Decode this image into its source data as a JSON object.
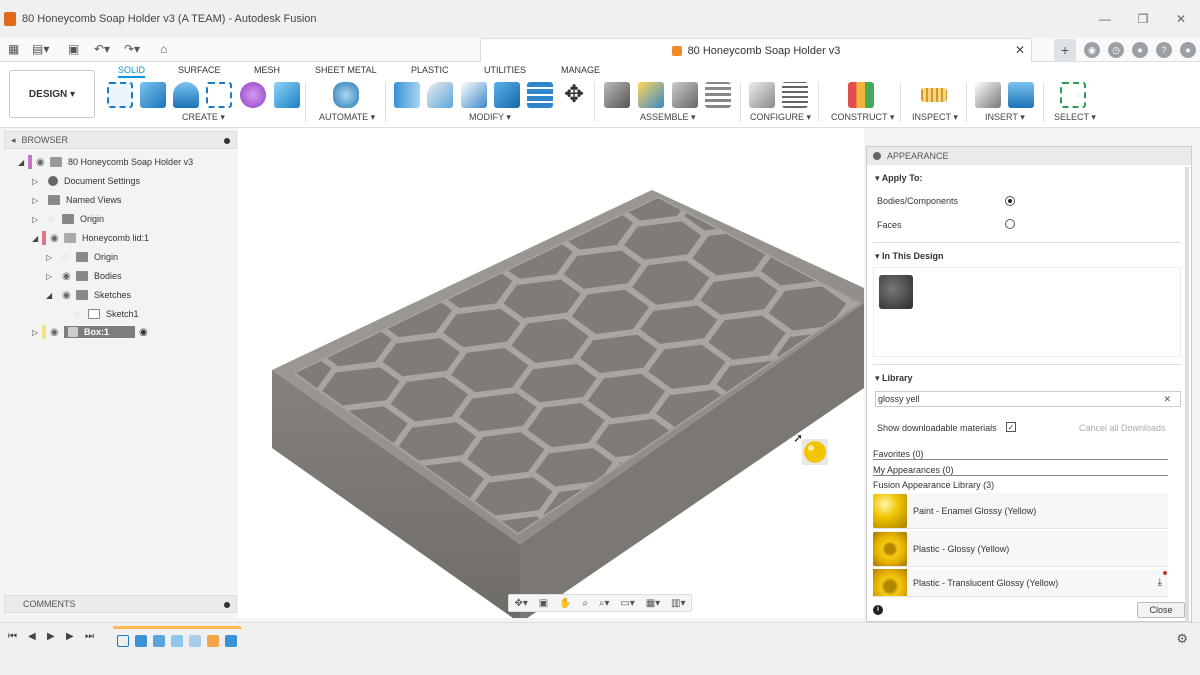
{
  "window": {
    "title": "80 Honeycomb Soap Holder v3 (A TEAM) - Autodesk Fusion",
    "controls": [
      "—",
      "❐",
      "✕"
    ]
  },
  "doc_tab": {
    "title": "80 Honeycomb Soap Holder v3"
  },
  "ribbon": {
    "workspace": "DESIGN",
    "tabs": [
      "SOLID",
      "SURFACE",
      "MESH",
      "SHEET METAL",
      "PLASTIC",
      "UTILITIES",
      "MANAGE"
    ],
    "groups": [
      "CREATE",
      "AUTOMATE",
      "MODIFY",
      "ASSEMBLE",
      "CONFIGURE",
      "CONSTRUCT",
      "INSPECT",
      "INSERT",
      "SELECT"
    ]
  },
  "browser": {
    "title": "BROWSER",
    "rows": [
      "80 Honeycomb Soap Holder v3",
      "Document Settings",
      "Named Views",
      "Origin",
      "Honeycomb lid:1",
      "Origin",
      "Bodies",
      "Sketches",
      "Sketch1",
      "Box:1"
    ]
  },
  "comments": {
    "title": "COMMENTS"
  },
  "appearance": {
    "title": "APPEARANCE",
    "apply_to": "Apply To:",
    "bodies_components": "Bodies/Components",
    "faces": "Faces",
    "in_this_design": "In This Design",
    "library": "Library",
    "search_value": "glossy yell",
    "show_downloadable": "Show downloadable materials",
    "cancel_downloads": "Cancel all Downloads",
    "favorites": "Favorites (0)",
    "my_appearances": "My Appearances (0)",
    "fusion_library": "Fusion Appearance Library (3)",
    "materials": [
      "Paint - Enamel Glossy (Yellow)",
      "Plastic - Glossy (Yellow)",
      "Plastic - Translucent Glossy (Yellow)"
    ],
    "close": "Close"
  },
  "colors": {
    "accent": "#0696d7",
    "yellow": "#f2c500",
    "model": "#8f8b86"
  }
}
